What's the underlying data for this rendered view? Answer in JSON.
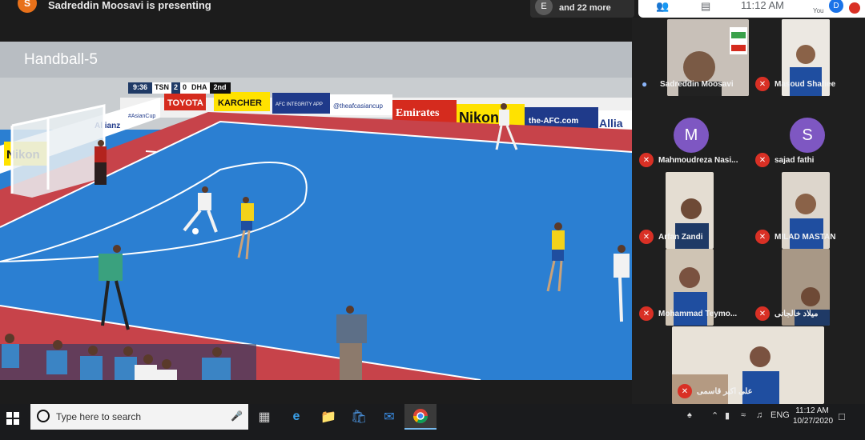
{
  "topbar": {
    "presenter_initial": "S",
    "presenter_text": "Sadreddin Moosavi is presenting",
    "others_initial": "E",
    "others_text": "and 22 more",
    "time": "11:12 AM",
    "you_label": "You",
    "you_initial": "D"
  },
  "video": {
    "title": "Handball-5",
    "scoreboard": {
      "clock": "9:36",
      "home": "TSN",
      "home_score": "2",
      "away_score": "0",
      "away": "DHA",
      "period": "2nd"
    },
    "ads": [
      "TOYOTA",
      "KARCHER",
      "AFC INTEGRITY APP",
      "@theafcasiancup",
      "Emirates",
      "Nikon",
      "the-AFC.com",
      "Allia",
      "Nikon",
      "Allianz",
      "#AsianCup"
    ]
  },
  "participants": [
    {
      "name": "Sadreddin Moosavi",
      "status": "speaking"
    },
    {
      "name": "Masoud Shafiee",
      "status": "muted"
    },
    {
      "name": "Mahmoudreza Nasi...",
      "status": "muted",
      "initial": "M"
    },
    {
      "name": "sajad fathi",
      "status": "muted",
      "initial": "S"
    },
    {
      "name": "Arfan Zandi",
      "status": "muted"
    },
    {
      "name": "MILAD MASTAN",
      "status": "muted"
    },
    {
      "name": "Mohammad Teymo...",
      "status": "muted"
    },
    {
      "name": "میلاد خالجانی",
      "status": "muted"
    },
    {
      "name": "علی اکبر قاسمی",
      "status": "muted"
    }
  ],
  "taskbar": {
    "search_placeholder": "Type here to search",
    "language": "ENG",
    "time": "11:12 AM",
    "date": "10/27/2020"
  },
  "colors": {
    "court": "#2b7fd2",
    "muted": "#d93025",
    "avatar_purple": "#7e57c2",
    "presenter_orange": "#e8711a"
  }
}
